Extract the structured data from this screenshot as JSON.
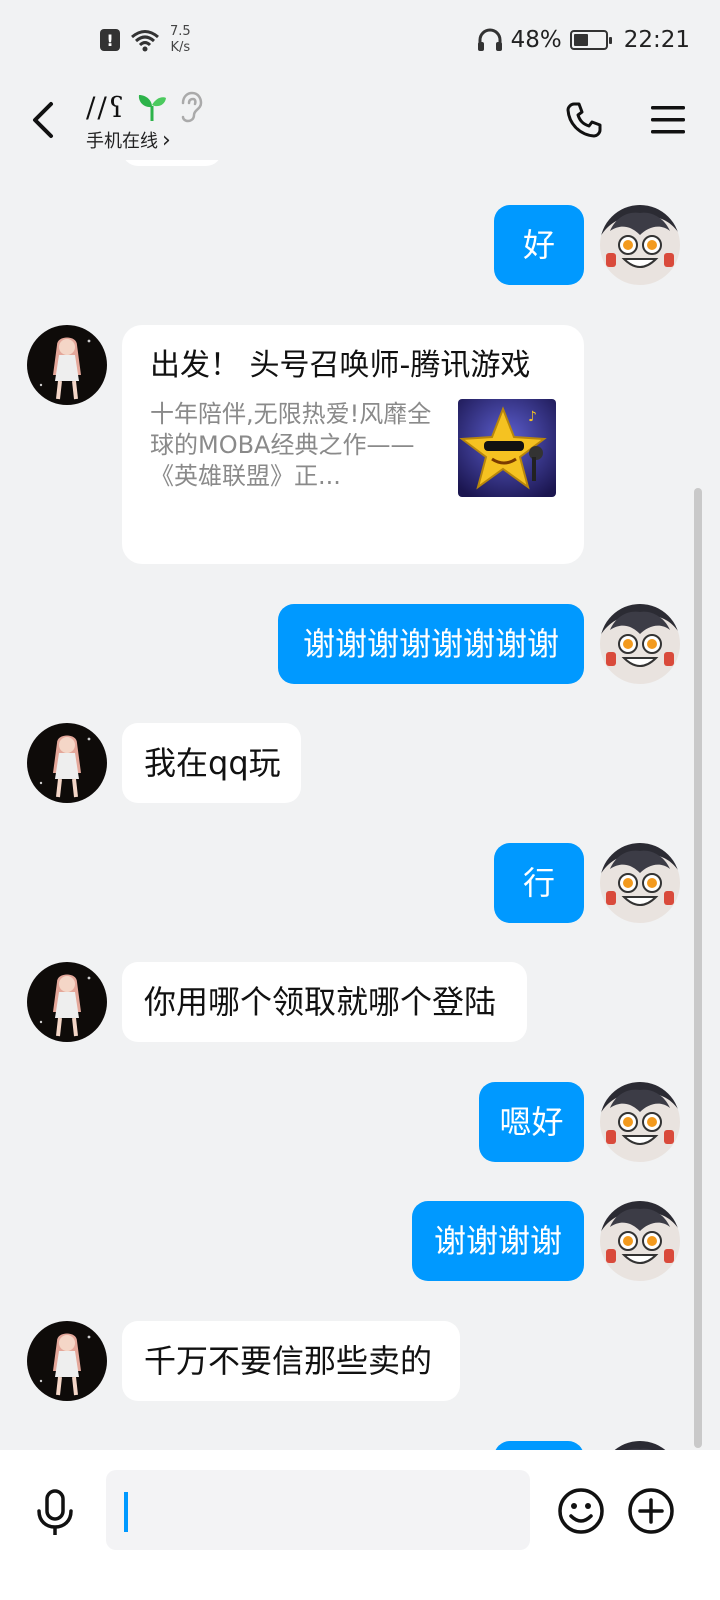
{
  "status_bar": {
    "net_speed_value": "7.5",
    "net_speed_unit": "K/s",
    "battery_percent": "48%",
    "battery_level": 0.48,
    "time": "22:21"
  },
  "header": {
    "contact_name": "//ʕ",
    "contact_status": "手机在线",
    "status_chevron": "›"
  },
  "messages": [
    {
      "side": "out",
      "text": "好"
    },
    {
      "side": "in",
      "type": "card",
      "title": "出发！ 头号召唤师-腾讯游戏",
      "desc": "十年陪伴,无限热爱!风靡全球的MOBA经典之作——《英雄联盟》正..."
    },
    {
      "side": "out",
      "text": "谢谢谢谢谢谢谢谢"
    },
    {
      "side": "in",
      "text": "我在qq玩"
    },
    {
      "side": "out",
      "text": "行"
    },
    {
      "side": "in",
      "text": "你用哪个领取就哪个登陆"
    },
    {
      "side": "out",
      "text": "嗯好"
    },
    {
      "side": "out",
      "text": "谢谢谢谢"
    },
    {
      "side": "in",
      "text": "千万不要信那些卖的"
    }
  ],
  "input": {
    "value": ""
  },
  "colors": {
    "accent": "#0099ff",
    "background": "#f1f2f3",
    "bubble_in": "#ffffff"
  },
  "icons": {
    "back": "chevron-left-icon",
    "sprout": "sprout-icon",
    "ear": "ear-icon",
    "phone": "phone-icon",
    "menu": "menu-icon",
    "mic": "microphone-icon",
    "emoji": "smiley-icon",
    "plus": "plus-circle-icon"
  }
}
